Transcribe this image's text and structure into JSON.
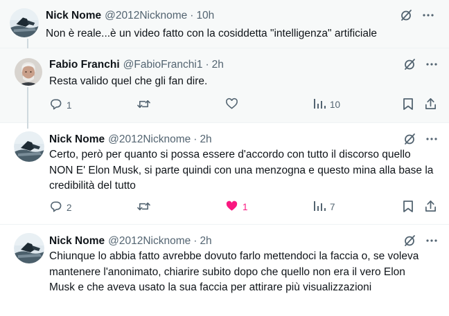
{
  "tweets": [
    {
      "name": "Nick Nome",
      "handle": "@2012Nicknome",
      "time": "10h",
      "text": "Non è reale...è un video fatto con la cosiddetta \"intelligenza\" artificiale"
    },
    {
      "name": "Fabio Franchi",
      "handle": "@FabioFranchi1",
      "time": "2h",
      "text": "Resta valido quel che gli fan dire.",
      "replies": "1",
      "views": "10"
    },
    {
      "name": "Nick Nome",
      "handle": "@2012Nicknome",
      "time": "2h",
      "text": "Certo, però per quanto si possa essere d'accordo con tutto il discorso quello NON E' Elon Musk, si parte quindi con una menzogna e questo mina alla base la credibilità del tutto",
      "replies": "2",
      "likes": "1",
      "views": "7"
    },
    {
      "name": "Nick Nome",
      "handle": "@2012Nicknome",
      "time": "2h",
      "text": "Chiunque lo abbia fatto avrebbe dovuto farlo mettendoci la faccia o, se voleva mantenere l'anonimato, chiarire subito dopo che quello non era il vero Elon Musk e che aveva usato la sua faccia per attirare più visualizzazioni"
    }
  ],
  "separator": "·",
  "icons": {
    "grok": "grok-slash-circle-icon",
    "more": "more-dots-icon",
    "reply": "reply-bubble-icon",
    "retweet": "retweet-arrows-icon",
    "like": "heart-icon",
    "views": "views-bar-chart-icon",
    "bookmark": "bookmark-icon",
    "share": "share-upload-icon"
  },
  "colors": {
    "text": "#0f1419",
    "secondary": "#536471",
    "like_active": "#f91880",
    "thread_line": "#cfd9de",
    "context_bg": "#f7f9f9"
  }
}
